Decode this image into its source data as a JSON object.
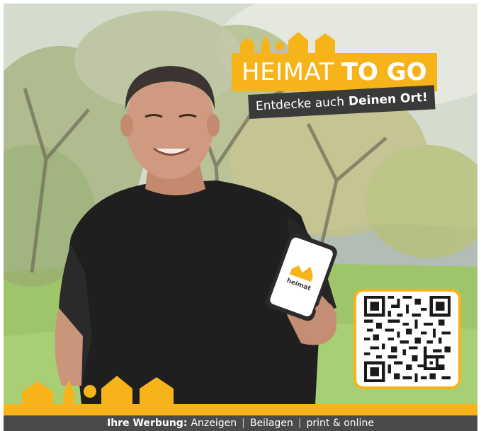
{
  "badge": {
    "title_light": "HEIMAT",
    "title_bold": "TO GO",
    "subtitle_light": "Entdecke auch",
    "subtitle_bold": "Deinen Ort!"
  },
  "phone": {
    "app_logo_text": "heimat"
  },
  "footer": {
    "label": "Ihre Werbung:",
    "items": [
      "Anzeigen",
      "Beilagen",
      "print & online"
    ]
  },
  "colors": {
    "brand_yellow": "#f6b41a",
    "dark_gray": "#3a3a3a",
    "shirt": "#1f1f1f"
  },
  "icons": [
    "town-skyline-icon",
    "qr-code-icon",
    "smartphone-icon"
  ]
}
